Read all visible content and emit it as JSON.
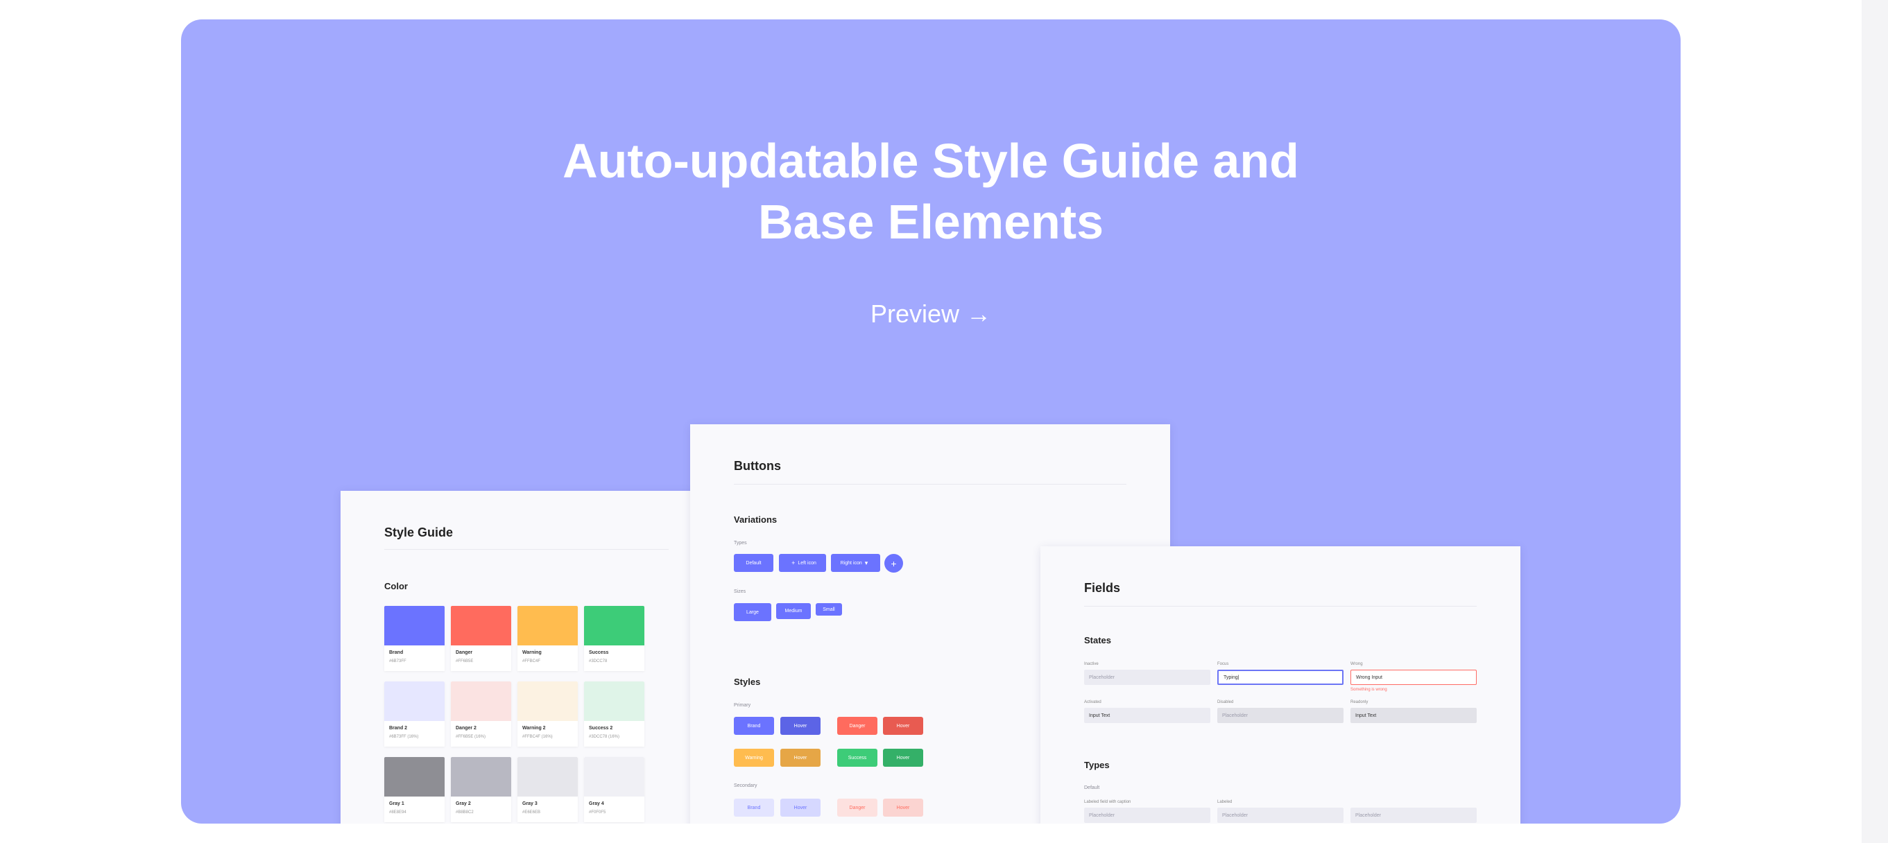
{
  "hero": {
    "title_line1": "Auto-updatable Style Guide and",
    "title_line2": "Base Elements",
    "preview_label": "Preview",
    "preview_arrow": "→",
    "background": "#a2a9fe"
  },
  "style_guide": {
    "title": "Style Guide",
    "section": "Color",
    "swatches": [
      {
        "name": "Brand",
        "hex": "#6B73FF",
        "color": "#6b73ff"
      },
      {
        "name": "Danger",
        "hex": "#FF6B5E",
        "color": "#ff6b5e"
      },
      {
        "name": "Warning",
        "hex": "#FFBC4F",
        "color": "#ffbc4f"
      },
      {
        "name": "Success",
        "hex": "#3DCC78",
        "color": "#3dcc78"
      },
      {
        "name": "Brand 2",
        "hex": "#6B73FF (16%)",
        "color": "#e6e7ff"
      },
      {
        "name": "Danger 2",
        "hex": "#FF6B5E (16%)",
        "color": "#fbe3e2"
      },
      {
        "name": "Warning 2",
        "hex": "#FFBC4F (16%)",
        "color": "#fcf2e2"
      },
      {
        "name": "Success 2",
        "hex": "#3DCC78 (16%)",
        "color": "#dff4e8"
      },
      {
        "name": "Gray 1",
        "hex": "#8E8E94",
        "color": "#8e8e94"
      },
      {
        "name": "Gray 2",
        "hex": "#B8B8C2",
        "color": "#b8b8c2"
      },
      {
        "name": "Gray 3",
        "hex": "#E6E6EB",
        "color": "#e6e6eb"
      },
      {
        "name": "Gray 4",
        "hex": "#F0F0F5",
        "color": "#f0f0f5"
      }
    ]
  },
  "buttons_card": {
    "title": "Buttons",
    "variations_title": "Variations",
    "types_label": "Types",
    "type_default": "Default",
    "type_left_icon": "Left icon",
    "type_right_icon": "Right icon",
    "type_plus": "+",
    "sizes_label": "Sizes",
    "size_large": "Large",
    "size_medium": "Medium",
    "size_small": "Small",
    "styles_title": "Styles",
    "primary_label": "Primary",
    "secondary_label": "Secondary",
    "brand": "Brand",
    "hover": "Hover",
    "danger": "Danger",
    "warning": "Warning",
    "success": "Success"
  },
  "fields_card": {
    "title": "Fields",
    "states_title": "States",
    "inactive_label": "Inactive",
    "inactive_placeholder": "Placeholder",
    "focus_label": "Focus",
    "focus_value": "Typing|",
    "wrong_label": "Wrong",
    "wrong_value": "Wrong Input",
    "wrong_message": "Something is wrong",
    "activated_label": "Activated",
    "activated_value": "Input Text",
    "disabled_label": "Disabled",
    "disabled_placeholder": "Placeholder",
    "readonly_label": "Readonly",
    "readonly_value": "Input Text",
    "types_title": "Types",
    "default_label": "Default",
    "type1_label": "Labeled field with caption",
    "type1_placeholder": "Placeholder",
    "type2_label": "Labeled",
    "type2_placeholder": "Placeholder",
    "type3_placeholder": "Placeholder"
  },
  "colors": {
    "brand": "#6b73ff",
    "brand_hover": "#5c64e6",
    "danger": "#ff6b5e",
    "danger_hover": "#e85b51",
    "warning": "#ffbc4f",
    "warning_hover": "#e6a646",
    "success": "#3dcc78",
    "success_hover": "#34b068"
  }
}
